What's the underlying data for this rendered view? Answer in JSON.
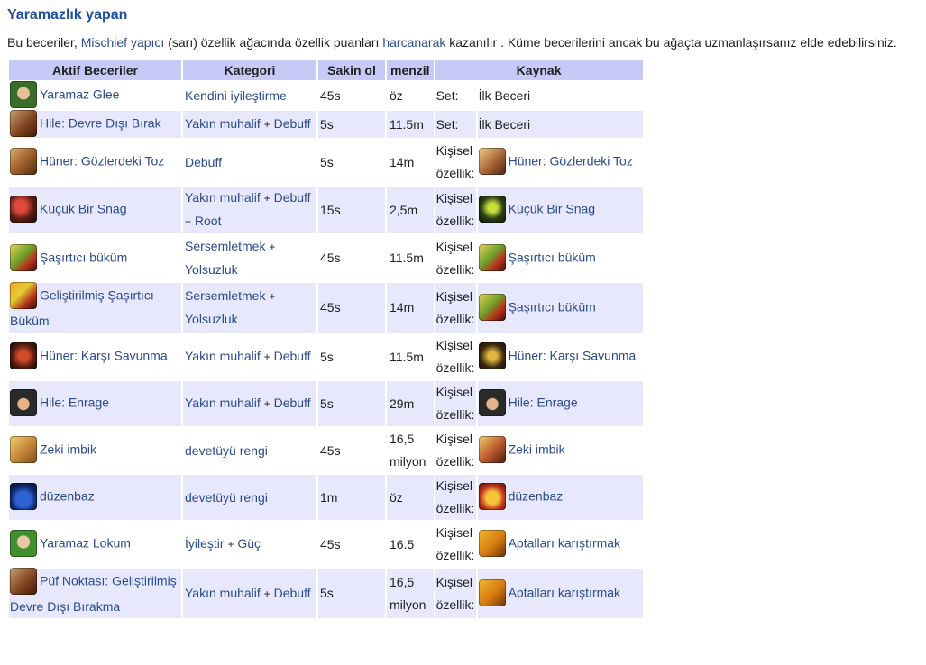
{
  "heading": "Yaramazlık yapan",
  "intro": {
    "p1": "Bu beceriler, ",
    "link1": "Mischief yapıcı",
    "p2": " (sarı) özellik ağacında özellik puanları ",
    "link2": "harcanarak",
    "p3": " kazanılır . Küme becerilerini ancak bu ağaçta uzmanlaşırsanız elde edebilirsiniz."
  },
  "columns": [
    "Aktif Beceriler",
    "Kategori",
    "Sakin ol",
    "menzil",
    "Kaynak"
  ],
  "plus": "+",
  "rows": [
    {
      "icon": "face-icon",
      "cls": "ic-face",
      "name": "Yaramaz Glee",
      "cat": [
        "Kendini iyileştirme"
      ],
      "cd": "45s",
      "range": "öz",
      "src_label": "Set:",
      "src_icon": "",
      "src_cls": "",
      "src": "İlk Beceri",
      "src_link": false
    },
    {
      "icon": "hand-icon",
      "cls": "ic-hand",
      "name": "Hile: Devre Dışı Bırak",
      "cat": [
        "Yakın muhalif",
        "Debuff"
      ],
      "cd": "5s",
      "range": "11.5m",
      "src_label": "Set:",
      "src_icon": "",
      "src_cls": "",
      "src": "İlk Beceri",
      "src_link": false
    },
    {
      "icon": "dust-icon",
      "cls": "ic-dust",
      "name": "Hüner: Gözlerdeki Toz",
      "cat": [
        "Debuff"
      ],
      "cd": "5s",
      "range": "14m",
      "src_label": "Kişisel özellik:",
      "src_icon": "dust-source-icon",
      "src_cls": "ic-dustsrc",
      "src": "Hüner: Gözlerdeki Toz",
      "src_link": true
    },
    {
      "icon": "snag-icon",
      "cls": "ic-snag",
      "name": "Küçük Bir Snag",
      "cat": [
        "Yakın muhalif",
        "Debuff",
        "Root"
      ],
      "cd": "15s",
      "range": "2,5m",
      "src_label": "Kişisel özellik:",
      "src_icon": "snag-source-icon",
      "src_cls": "ic-snagsrc",
      "src": "Küçük Bir Snag",
      "src_link": true
    },
    {
      "icon": "twist-icon",
      "cls": "ic-twist",
      "name": "Şaşırtıcı büküm",
      "cat": [
        "Sersemletmek",
        "Yolsuzluk"
      ],
      "cd": "45s",
      "range": "11.5m",
      "src_label": "Kişisel özellik:",
      "src_icon": "twist-source-icon",
      "src_cls": "ic-twist",
      "src": "Şaşırtıcı büküm",
      "src_link": true
    },
    {
      "icon": "twist-improved-icon",
      "cls": "ic-twist2",
      "name": "Geliştirilmiş Şaşırtıcı Büküm",
      "cat": [
        "Sersemletmek",
        "Yolsuzluk"
      ],
      "cd": "45s",
      "range": "14m",
      "src_label": "Kişisel özellik:",
      "src_icon": "twist-source-icon",
      "src_cls": "ic-twist",
      "src": "Şaşırtıcı büküm",
      "src_link": true
    },
    {
      "icon": "counter-icon",
      "cls": "ic-counter",
      "name": "Hüner: Karşı Savunma",
      "cat": [
        "Yakın muhalif",
        "Debuff"
      ],
      "cd": "5s",
      "range": "11.5m",
      "src_label": "Kişisel özellik:",
      "src_icon": "counter-source-icon",
      "src_cls": "ic-ctrsrc",
      "src": "Hüner: Karşı Savunma",
      "src_link": true
    },
    {
      "icon": "enrage-icon",
      "cls": "ic-enrage",
      "name": "Hile: Enrage",
      "cat": [
        "Yakın muhalif",
        "Debuff"
      ],
      "cd": "5s",
      "range": "29m",
      "src_label": "Kişisel özellik:",
      "src_icon": "enrage-source-icon",
      "src_cls": "ic-enrage",
      "src": "Hile: Enrage",
      "src_link": true
    },
    {
      "icon": "palm-icon",
      "cls": "ic-palm",
      "name": "Zeki imbik",
      "cat": [
        "devetüyü rengi"
      ],
      "cd": "45s",
      "range": "16,5 milyon",
      "src_label": "Kişisel özellik:",
      "src_icon": "palm-source-icon",
      "src_cls": "ic-palmsrc",
      "src": "Zeki imbik",
      "src_link": true
    },
    {
      "icon": "jester-icon",
      "cls": "ic-jester",
      "name": "düzenbaz",
      "cat": [
        "devetüyü rengi"
      ],
      "cd": "1m",
      "range": "öz",
      "src_label": "Kişisel özellik:",
      "src_icon": "jester-source-icon",
      "src_cls": "ic-jestsrc",
      "src": "düzenbaz",
      "src_link": true
    },
    {
      "icon": "lokum-icon",
      "cls": "ic-lokum",
      "name": "Yaramaz Lokum",
      "cat": [
        "İyileştir",
        "Güç"
      ],
      "cd": "45s",
      "range": "16.5",
      "src_label": "Kişisel özellik:",
      "src_icon": "fools-icon",
      "src_cls": "ic-fools",
      "src": "Aptalları karıştırmak",
      "src_link": true
    },
    {
      "icon": "hand-improved-icon",
      "cls": "ic-hand",
      "name": "Püf Noktası: Geliştirilmiş Devre Dışı Bırakma",
      "cat": [
        "Yakın muhalif",
        "Debuff"
      ],
      "cd": "5s",
      "range": "16,5 milyon",
      "src_label": "Kişisel özellik:",
      "src_icon": "fools-icon",
      "src_cls": "ic-fools",
      "src": "Aptalları karıştırmak",
      "src_link": true
    }
  ]
}
